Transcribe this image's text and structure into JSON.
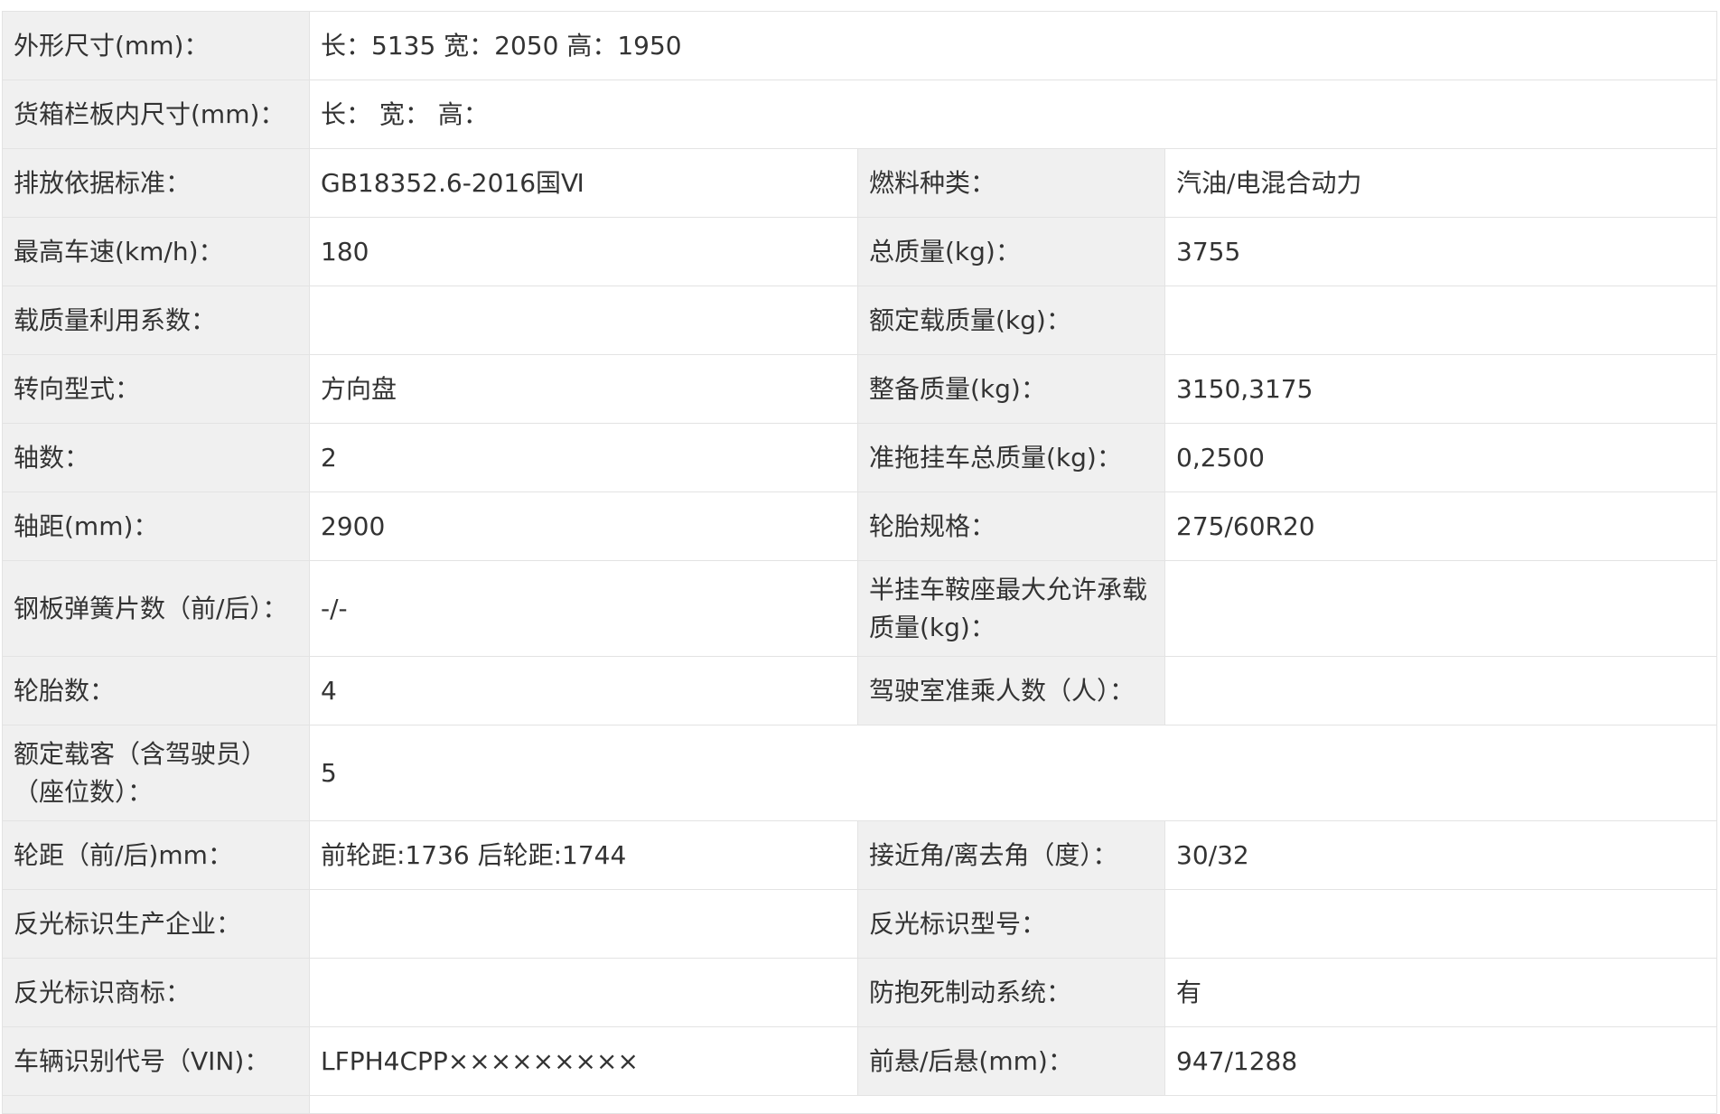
{
  "rows": [
    {
      "label": "外形尺寸(mm)：",
      "value": "长：5135 宽：2050 高：1950"
    },
    {
      "label": "货箱栏板内尺寸(mm)：",
      "value": "长：  宽：  高："
    },
    {
      "label": "排放依据标准：",
      "value": "GB18352.6-2016国Ⅵ",
      "label2": "燃料种类：",
      "value2": "汽油/电混合动力"
    },
    {
      "label": "最高车速(km/h)：",
      "value": "180",
      "label2": "总质量(kg)：",
      "value2": "3755"
    },
    {
      "label": "载质量利用系数：",
      "value": "",
      "label2": "额定载质量(kg)：",
      "value2": ""
    },
    {
      "label": "转向型式：",
      "value": "方向盘",
      "label2": "整备质量(kg)：",
      "value2": "3150,3175"
    },
    {
      "label": "轴数：",
      "value": "2",
      "label2": "准拖挂车总质量(kg)：",
      "value2": "0,2500"
    },
    {
      "label": "轴距(mm)：",
      "value": "2900",
      "label2": "轮胎规格：",
      "value2": "275/60R20"
    },
    {
      "label": "钢板弹簧片数（前/后）：",
      "value": "-/-",
      "label2": "半挂车鞍座最大允许承载质量(kg)：",
      "value2": ""
    },
    {
      "label": "轮胎数：",
      "value": "4",
      "label2": "驾驶室准乘人数（人）：",
      "value2": ""
    },
    {
      "label": "额定载客（含驾驶员）（座位数）：",
      "value": "5"
    },
    {
      "label": "轮距（前/后)mm：",
      "value": "前轮距:1736 后轮距:1744",
      "label2": "接近角/离去角（度）：",
      "value2": "30/32"
    },
    {
      "label": "反光标识生产企业：",
      "value": "",
      "label2": "反光标识型号：",
      "value2": ""
    },
    {
      "label": "反光标识商标：",
      "value": "",
      "label2": "防抱死制动系统：",
      "value2": "有"
    },
    {
      "label": "车辆识别代号（VIN)：",
      "value": "LFPH4CPP×××××××××",
      "label2": "前悬/后悬(mm)：",
      "value2": "947/1288"
    }
  ]
}
